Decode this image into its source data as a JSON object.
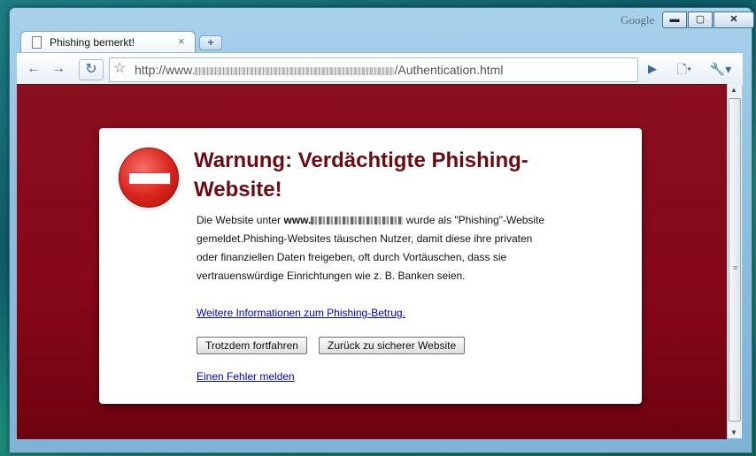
{
  "window": {
    "brand": "Google",
    "controls": {
      "minimize": "▬",
      "maximize": "▢",
      "close": "✕"
    }
  },
  "tab": {
    "title": "Phishing bemerkt!",
    "close": "×",
    "new_tab": "+"
  },
  "toolbar": {
    "url_prefix": "http://www.",
    "url_suffix": "/Authentication.html",
    "back_icon": "arrow-left-icon",
    "forward_icon": "arrow-right-icon",
    "reload_icon": "reload-icon",
    "bookmark_icon": "star-icon",
    "go_icon": "play-icon",
    "page_menu_icon": "page-icon",
    "tools_menu_icon": "wrench-icon"
  },
  "warning": {
    "heading": "Warnung: Verdächtigte Phishing-Website!",
    "text_before": "Die Website unter ",
    "text_domain_prefix": "www.",
    "text_after": " wurde als \"Phishing\"-Website gemeldet.Phishing-Websites täuschen Nutzer, damit diese ihre privaten oder finanziellen Daten freigeben, oft durch Vortäuschen, dass sie vertrauenswürdige Einrichtungen wie z. B. Banken seien.",
    "more_info_link": "Weitere Informationen zum Phishing-Betrug.",
    "proceed_button": "Trotzdem fortfahren",
    "back_button": "Zurück zu sicherer Website",
    "report_link": "Einen Fehler melden"
  },
  "colors": {
    "background": "#85071a",
    "heading": "#6a0c14",
    "link": "#0000cc"
  }
}
